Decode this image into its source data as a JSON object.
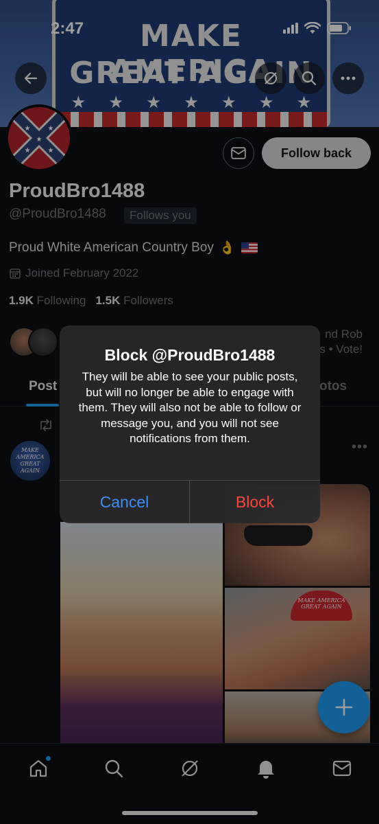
{
  "status_bar": {
    "time": "2:47"
  },
  "banner": {
    "line1": "MAKE AMERICA",
    "line2": "GREAT AGAIN"
  },
  "profile": {
    "display_name": "ProudBro1488",
    "handle": "@ProudBro1488",
    "follows_you": "Follows you",
    "bio": "Proud White American Country Boy",
    "joined": "Joined February 2022",
    "following_count": "1.9K",
    "following_label": "Following",
    "followers_count": "1.5K",
    "followers_label": "Followers",
    "follow_back_label": "Follow back"
  },
  "mutuals": {
    "line1": "nd Rob",
    "line2": "s • Vote!"
  },
  "tabs": [
    {
      "label": "Post"
    },
    {
      "label": "otos"
    }
  ],
  "post": {
    "avatar_text_1": "MAKE AMERICA",
    "avatar_text_2": "GREAT AGAIN",
    "cap_text": "MAKE AMERICA GREAT AGAIN"
  },
  "dialog": {
    "title": "Block @ProudBro1488",
    "message": "They will be able to see your public posts, but will no longer be able to engage with them. They will also not be able to follow or message you, and you will not see notifications from them.",
    "cancel_label": "Cancel",
    "block_label": "Block"
  },
  "colors": {
    "accent": "#1d9bf0",
    "destructive": "#ff453a",
    "ios_blue": "#3d8ef7"
  },
  "nav_icons": [
    "home-icon",
    "search-icon",
    "grok-icon",
    "bell-icon",
    "mail-icon"
  ]
}
